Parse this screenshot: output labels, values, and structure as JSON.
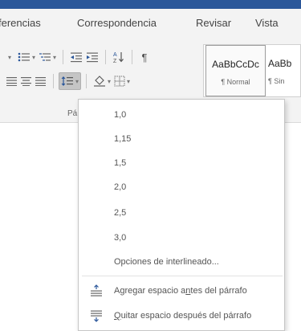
{
  "menu": {
    "items": [
      "ferencias",
      "Correspondencia",
      "Revisar",
      "Vista"
    ]
  },
  "ribbon": {
    "group_label": "Pá",
    "row1_buttons": [
      "list-bullets-icon",
      "list-numbered-icon",
      "list-multilevel-icon",
      "decrease-indent-icon",
      "increase-indent-icon",
      "sort-icon",
      "pilcrow-icon"
    ],
    "row2_buttons": [
      "align-left-icon",
      "align-center-icon",
      "align-right-icon",
      "line-spacing-icon",
      "shading-icon",
      "borders-icon"
    ],
    "sort_glyph": "A Z ↓",
    "pilcrow_glyph": "¶"
  },
  "styles": [
    {
      "sample": "AaBbCcDc",
      "name": "¶ Normal"
    },
    {
      "sample": "AaBb",
      "name": "¶ Sin"
    }
  ],
  "line_spacing_menu": {
    "options": [
      "1,0",
      "1,15",
      "1,5",
      "2,0",
      "2,5",
      "3,0"
    ],
    "more_options": "Opciones de interlineado...",
    "add_before": {
      "pre": "Agregar espacio a",
      "ul": "n",
      "post": "tes del párrafo"
    },
    "remove_after": {
      "pre": "",
      "ul": "Q",
      "post": "uitar espacio después del párrafo"
    }
  },
  "colors": {
    "title_bar": "#2b579a",
    "ribbon_bg": "#f3f3f3",
    "icon_blue": "#2b579a"
  }
}
